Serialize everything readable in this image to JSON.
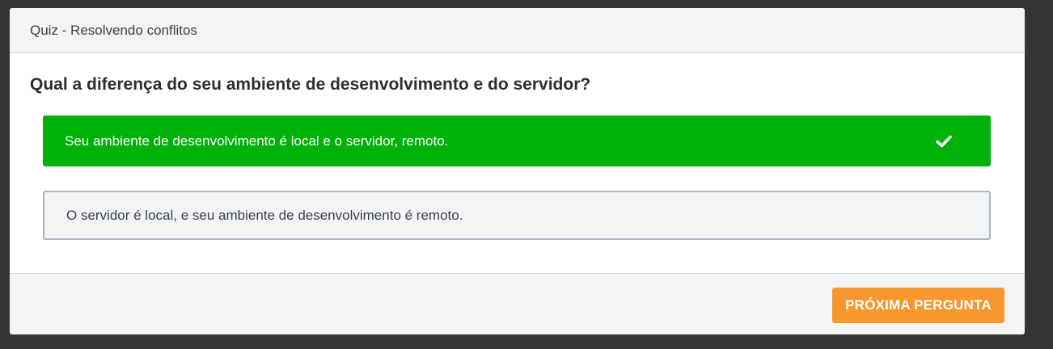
{
  "modal": {
    "title": "Quiz - Resolvendo conflitos",
    "question": "Qual a diferença do seu ambiente de desenvolvimento e do servidor?",
    "answers": [
      {
        "text": "Seu ambiente de desenvolvimento é local e o servidor, remoto.",
        "state": "correct",
        "icon": "check-icon"
      },
      {
        "text": "O servidor é local, e seu ambiente de desenvolvimento é remoto.",
        "state": "unselected"
      }
    ],
    "next_button_label": "PRÓXIMA PERGUNTA"
  },
  "colors": {
    "backdrop": "#333333",
    "correct": "#00b109",
    "accent": "#f7972e",
    "panel": "#f3f4f6"
  }
}
